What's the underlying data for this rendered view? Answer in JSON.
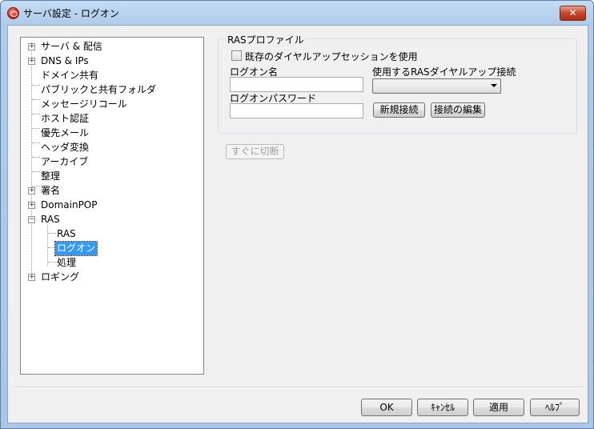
{
  "window": {
    "title": "サーバ設定 - ログオン",
    "close_glyph": "✕"
  },
  "tree": {
    "items": [
      {
        "label": "サーバ & 配信",
        "expander": "+"
      },
      {
        "label": "DNS & IPs",
        "expander": "+"
      },
      {
        "label": "ドメイン共有",
        "expander": ""
      },
      {
        "label": "パブリックと共有フォルダ",
        "expander": ""
      },
      {
        "label": "メッセージリコール",
        "expander": ""
      },
      {
        "label": "ホスト認証",
        "expander": ""
      },
      {
        "label": "優先メール",
        "expander": ""
      },
      {
        "label": "ヘッダ変換",
        "expander": ""
      },
      {
        "label": "アーカイブ",
        "expander": ""
      },
      {
        "label": "整理",
        "expander": ""
      },
      {
        "label": "署名",
        "expander": "+"
      },
      {
        "label": "DomainPOP",
        "expander": "+"
      },
      {
        "label": "RAS",
        "expander": "−"
      },
      {
        "label": "RAS",
        "expander": ""
      },
      {
        "label": "ログオン",
        "expander": "",
        "selected": true
      },
      {
        "label": "処理",
        "expander": ""
      },
      {
        "label": "ロギング",
        "expander": "+"
      }
    ]
  },
  "ras_profile": {
    "group_label": "RASプロファイル",
    "use_existing_label": "既存のダイヤルアップセッションを使用",
    "use_existing_checked": false,
    "logon_name_label": "ログオン名",
    "logon_name_value": "",
    "logon_password_label": "ログオンパスワード",
    "logon_password_value": "",
    "connection_label": "使用するRASダイヤルアップ接続",
    "connection_value": "",
    "new_connection_button": "新規接続",
    "edit_connection_button": "接続の編集"
  },
  "disconnect_button": "すぐに切断",
  "footer": {
    "ok": "OK",
    "cancel": "ｷｬﾝｾﾙ",
    "apply": "適用",
    "help": "ﾍﾙﾌﾟ"
  }
}
